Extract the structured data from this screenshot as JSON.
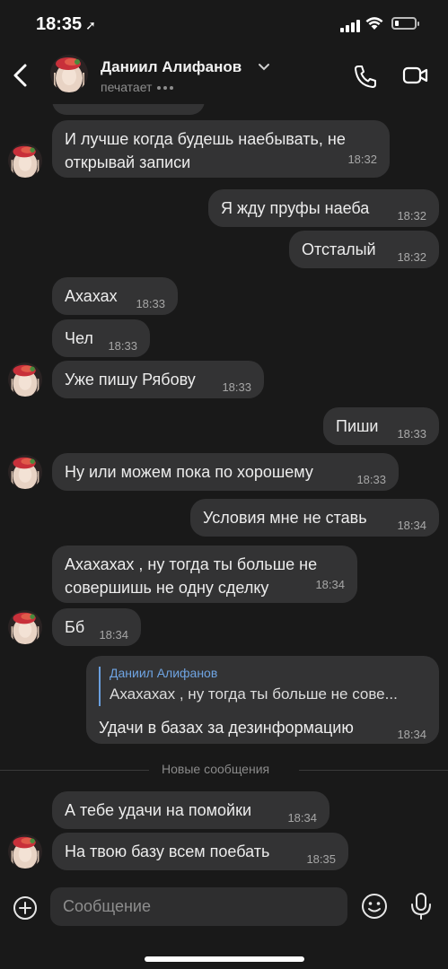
{
  "status_bar": {
    "time": "18:35",
    "location_arrow": "location-arrow-icon"
  },
  "header": {
    "name": "Даниил Алифанов",
    "status": "печатает",
    "icons": [
      "back-icon",
      "chevron-down-icon",
      "phone-icon",
      "video-icon"
    ]
  },
  "messages": [
    {
      "side": "left",
      "text_lines": [
        "И лучше когда будешь наебывать, не",
        "открывай записи"
      ],
      "time": "18:32",
      "avatar": true
    },
    {
      "side": "right",
      "text_lines": [
        "Я жду пруфы наеба"
      ],
      "time": "18:32"
    },
    {
      "side": "right",
      "text_lines": [
        "Отсталый"
      ],
      "time": "18:32"
    },
    {
      "side": "left",
      "text_lines": [
        "Ахахах"
      ],
      "time": "18:33",
      "avatar": false
    },
    {
      "side": "left",
      "text_lines": [
        "Чел"
      ],
      "time": "18:33",
      "avatar": false
    },
    {
      "side": "left",
      "text_lines": [
        "Уже пишу Рябову"
      ],
      "time": "18:33",
      "avatar": true
    },
    {
      "side": "right",
      "text_lines": [
        "Пиши"
      ],
      "time": "18:33"
    },
    {
      "side": "left",
      "text_lines": [
        "Ну или можем пока по хорошему"
      ],
      "time": "18:33",
      "avatar": true
    },
    {
      "side": "right",
      "text_lines": [
        "Условия мне не ставь"
      ],
      "time": "18:34"
    },
    {
      "side": "left",
      "text_lines": [
        "Ахахахах , ну тогда ты больше не",
        "совершишь не одну сделку"
      ],
      "time": "18:34",
      "avatar": false
    },
    {
      "side": "left",
      "text_lines": [
        "Бб"
      ],
      "time": "18:34",
      "avatar": true
    }
  ],
  "reply_message": {
    "quoted_name": "Даниил Алифанов",
    "quoted_text": "Ахахахах , ну тогда ты больше не сове...",
    "text": "Удачи в базах за дезинформацию",
    "time": "18:34"
  },
  "new_messages_label": "Новые сообщения",
  "new_messages": [
    {
      "side": "left",
      "text": "А тебе удачи на помойки",
      "time": "18:34",
      "avatar": false
    },
    {
      "side": "left",
      "text": "На твою базу всем поебать",
      "time": "18:35",
      "avatar": true
    }
  ],
  "composer": {
    "placeholder": "Сообщение",
    "icons": [
      "plus-icon",
      "emoji-icon",
      "microphone-icon"
    ]
  },
  "colors": {
    "background": "#191919",
    "bubble": "#333334",
    "accent": "#6a9fde"
  }
}
